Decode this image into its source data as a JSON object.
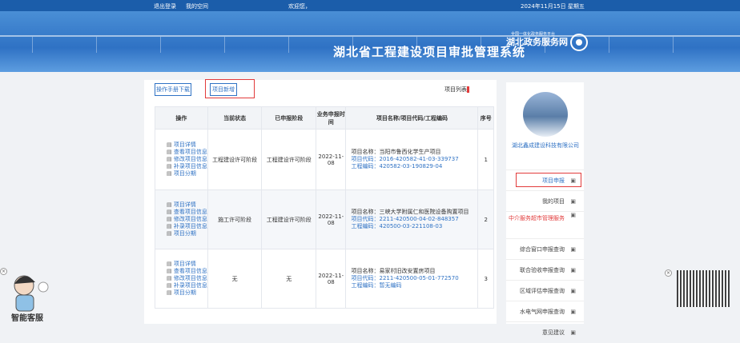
{
  "topbar": {
    "left_links": [
      "退出登录",
      "我的空间"
    ],
    "welcome": "欢迎您，",
    "date": "2024年11月15日 星期五"
  },
  "banner": {
    "site_name": "湖北政务服务网",
    "site_sub": "全国一体化政务服务平台",
    "system_title": "湖北省工程建设项目审批管理系统"
  },
  "toolbar": {
    "btn_project": "项目列表",
    "btn_add": "项目新增",
    "btn_help": "操作手册下载"
  },
  "table": {
    "headers": [
      "序号",
      "项目名称/项目代码/工程编码",
      "业务申报时间",
      "已申报阶段",
      "当前状态",
      "操作"
    ],
    "rows": [
      {
        "no": "1",
        "name": "项目名称：当阳市鲁西化学生产项目",
        "code": "项目代码：2016-420582-41-03-339737",
        "eng": "工程编码：420582-03-190829-04",
        "time": "2022-11-08",
        "stage": "工程建设许可阶段",
        "status": "工程建设许可阶段",
        "ops": [
          "项目详情",
          "查看项目信息",
          "修改项目信息",
          "补录项目信息",
          "项目分期"
        ]
      },
      {
        "no": "2",
        "name": "项目名称：三峡大学附属仁和医院设备购置项目",
        "code": "项目代码：2211-420500-04-02-848357",
        "eng": "工程编码：420500-03-221108-03",
        "time": "2022-11-08",
        "stage": "工程建设许可阶段",
        "status": "施工许可阶段",
        "ops": [
          "项目详情",
          "查看项目信息",
          "修改项目信息",
          "补录项目信息",
          "项目分期"
        ]
      },
      {
        "no": "3",
        "name": "项目名称：易家村旧改安置房项目",
        "code": "项目代码：2211-420500-05-01-772570",
        "eng": "工程编码：暂无编码",
        "time": "2022-11-08",
        "stage": "无",
        "status": "无",
        "ops": [
          "项目详情",
          "查看项目信息",
          "修改项目信息",
          "补录项目信息",
          "项目分期"
        ]
      }
    ]
  },
  "sidebar": {
    "company": "湖北鑫成建设科技有限公司",
    "items": [
      "项目申报",
      "我的项目",
      "中介服务超市管理服务",
      "综合窗口申报查询",
      "联合验收申报查询",
      "区域评估申报查询",
      "水电气网申报查询",
      "意见建议"
    ]
  },
  "mascot_caption": "智能客服"
}
